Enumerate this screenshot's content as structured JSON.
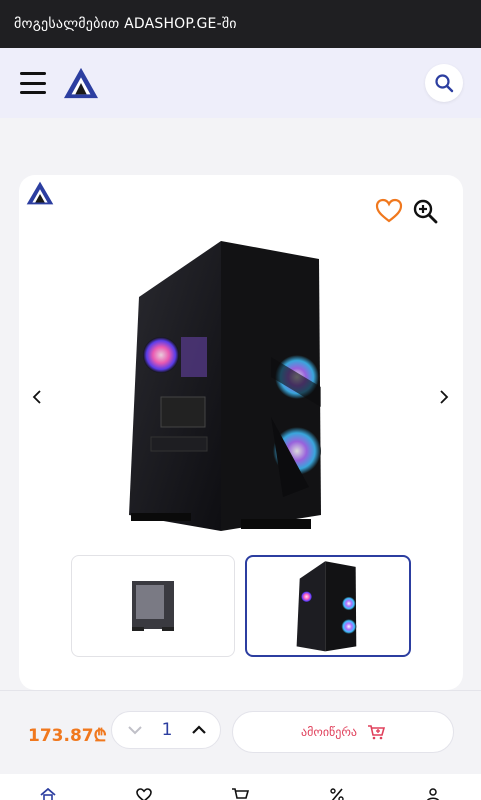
{
  "topbar": {
    "welcome": "მოგესალმებით ADASHOP.GE-ში"
  },
  "header": {
    "menu_icon": "hamburger-menu-icon",
    "logo_icon": "ada-logo-icon",
    "search_icon": "search-icon"
  },
  "colors": {
    "brand_blue": "#2c3ea0",
    "price_orange": "#f0781e",
    "buy_red": "#e0405b",
    "topbar_bg": "#1f1f22",
    "header_bg": "#eeeefa"
  },
  "product": {
    "images": [
      {
        "thumb_name": "product-thumbnail-1",
        "selected": false
      },
      {
        "thumb_name": "product-thumbnail-2",
        "selected": true
      }
    ]
  },
  "purchase": {
    "price": "173.87₾",
    "quantity": "1",
    "buy_label": "ამოიწერა"
  },
  "nav": {
    "items": [
      {
        "icon": "home-icon"
      },
      {
        "icon": "heart-icon"
      },
      {
        "icon": "cart-icon"
      },
      {
        "icon": "percent-icon"
      },
      {
        "icon": "user-icon"
      }
    ]
  }
}
